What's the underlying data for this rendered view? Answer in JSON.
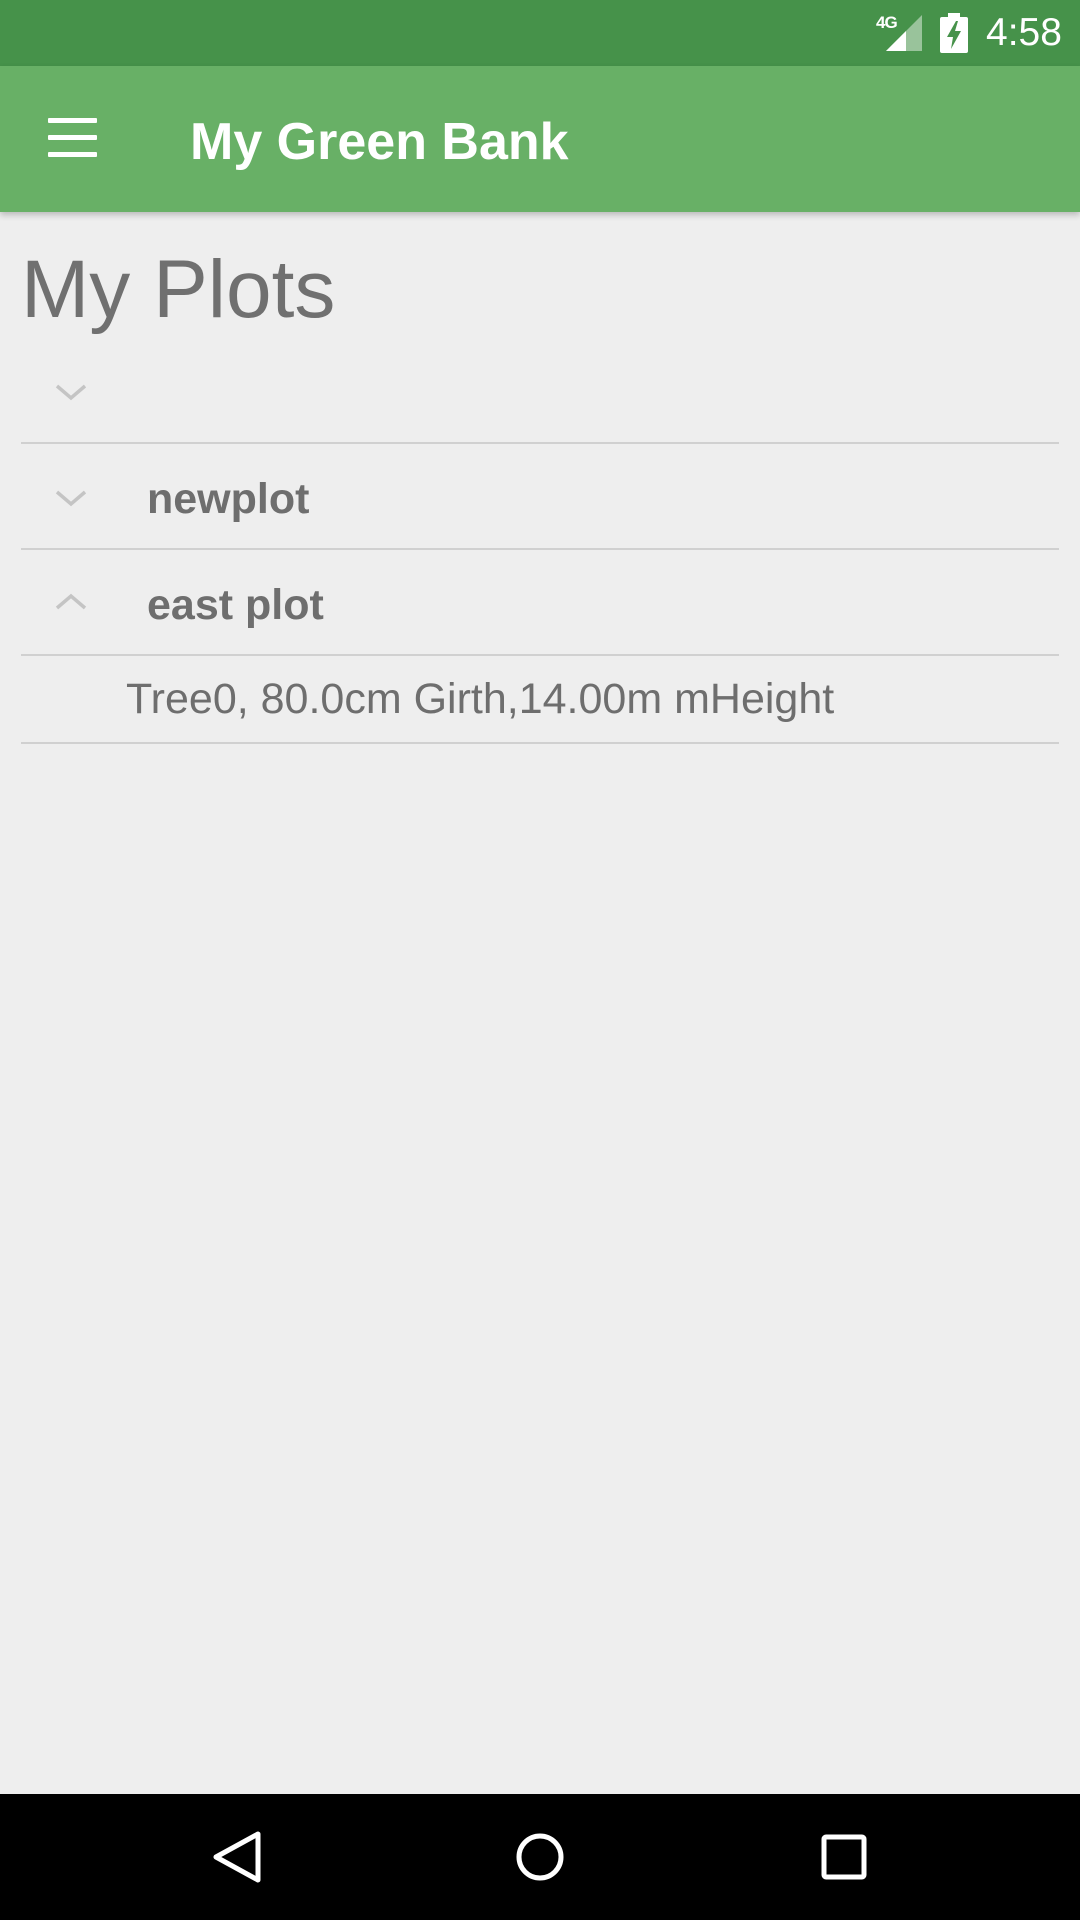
{
  "status_bar": {
    "network": "4G",
    "time": "4:58",
    "icons": [
      "signal-icon",
      "battery-charging-icon"
    ]
  },
  "app_bar": {
    "title": "My Green Bank",
    "menu_icon": "hamburger-menu-icon"
  },
  "main": {
    "page_title": "My Plots",
    "plots": [
      {
        "name": "",
        "expanded": false,
        "icon": "chevron-down-icon"
      },
      {
        "name": "newplot",
        "expanded": false,
        "icon": "chevron-down-icon"
      },
      {
        "name": "east plot",
        "expanded": true,
        "icon": "chevron-up-icon",
        "trees": [
          {
            "label": "Tree0, 80.0cm Girth,14.00m mHeight"
          }
        ]
      }
    ]
  },
  "nav_bar": {
    "buttons": [
      "back-icon",
      "home-icon",
      "recents-icon"
    ]
  },
  "colors": {
    "status_bar": "#46924a",
    "app_bar": "#68b066",
    "background": "#eeeeee",
    "text": "#6e6e6e"
  }
}
